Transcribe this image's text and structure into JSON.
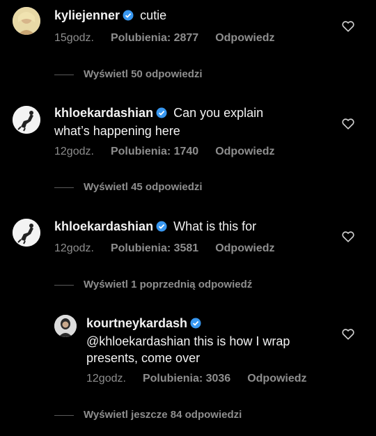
{
  "colors": {
    "background": "#000000",
    "text": "#f2f2f2",
    "muted": "#8e8e8e",
    "verified": "#3897f0"
  },
  "comments": [
    {
      "username": "kyliejenner",
      "text": "cutie",
      "time": "15godz.",
      "likes": "Polubienia: 2877",
      "reply": "Odpowiedz",
      "view_replies": "Wyświetl 50 odpowiedzi"
    },
    {
      "username": "khloekardashian",
      "text_line1": "Can you explain",
      "text_line2": "what’s happening here",
      "time": "12godz.",
      "likes": "Polubienia: 1740",
      "reply": "Odpowiedz",
      "view_replies": "Wyświetl 45 odpowiedzi"
    },
    {
      "username": "khloekardashian",
      "text": "What is this for",
      "time": "12godz.",
      "likes": "Polubienia: 3581",
      "reply": "Odpowiedz",
      "view_replies": "Wyświetl 1 poprzednią odpowiedź"
    }
  ],
  "reply": {
    "username": "kourtneykardash",
    "text_line1": "@khloekardashian this is how I wrap",
    "text_line2": "presents, come over",
    "time": "12godz.",
    "likes": "Polubienia: 3036",
    "reply": "Odpowiedz"
  },
  "view_more": "Wyświetl jeszcze 84 odpowiedzi",
  "icons": {
    "like": "heart-outline-icon",
    "verified": "verified-badge-icon"
  }
}
